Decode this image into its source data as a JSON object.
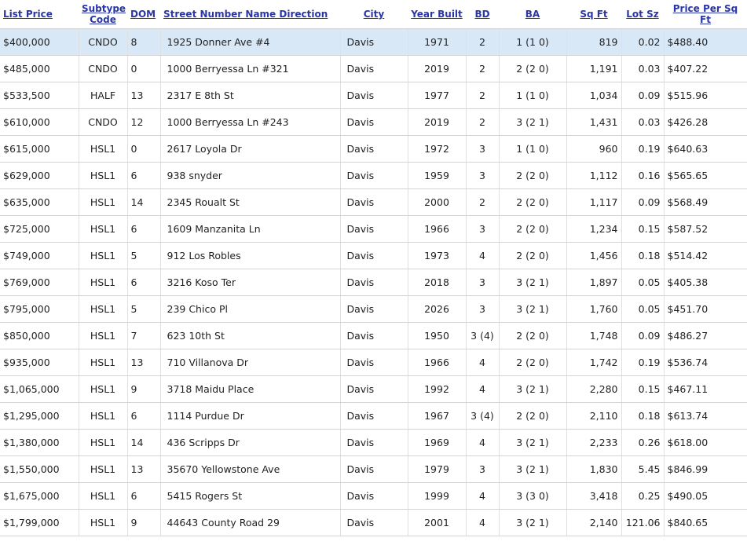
{
  "table": {
    "headers": [
      "List Price",
      "Subtype Code",
      "DOM",
      "Street Number Name Direction",
      "City",
      "Year Built",
      "BD",
      "BA",
      "Sq Ft",
      "Lot Sz",
      "Price Per Sq Ft"
    ],
    "rows": [
      [
        "$400,000",
        "CNDO",
        "8",
        "1925 Donner Ave #4",
        "Davis",
        "1971",
        "2",
        "1 (1 0)",
        "819",
        "0.02",
        "$488.40"
      ],
      [
        "$485,000",
        "CNDO",
        "0",
        "1000 Berryessa Ln #321",
        "Davis",
        "2019",
        "2",
        "2 (2 0)",
        "1,191",
        "0.03",
        "$407.22"
      ],
      [
        "$533,500",
        "HALF",
        "13",
        "2317 E 8th St",
        "Davis",
        "1977",
        "2",
        "1 (1 0)",
        "1,034",
        "0.09",
        "$515.96"
      ],
      [
        "$610,000",
        "CNDO",
        "12",
        "1000 Berryessa Ln #243",
        "Davis",
        "2019",
        "2",
        "3 (2 1)",
        "1,431",
        "0.03",
        "$426.28"
      ],
      [
        "$615,000",
        "HSL1",
        "0",
        "2617 Loyola Dr",
        "Davis",
        "1972",
        "3",
        "1 (1 0)",
        "960",
        "0.19",
        "$640.63"
      ],
      [
        "$629,000",
        "HSL1",
        "6",
        "938 snyder",
        "Davis",
        "1959",
        "3",
        "2 (2 0)",
        "1,112",
        "0.16",
        "$565.65"
      ],
      [
        "$635,000",
        "HSL1",
        "14",
        "2345 Roualt St",
        "Davis",
        "2000",
        "2",
        "2 (2 0)",
        "1,117",
        "0.09",
        "$568.49"
      ],
      [
        "$725,000",
        "HSL1",
        "6",
        "1609 Manzanita Ln",
        "Davis",
        "1966",
        "3",
        "2 (2 0)",
        "1,234",
        "0.15",
        "$587.52"
      ],
      [
        "$749,000",
        "HSL1",
        "5",
        "912 Los Robles",
        "Davis",
        "1973",
        "4",
        "2 (2 0)",
        "1,456",
        "0.18",
        "$514.42"
      ],
      [
        "$769,000",
        "HSL1",
        "6",
        "3216 Koso Ter",
        "Davis",
        "2018",
        "3",
        "3 (2 1)",
        "1,897",
        "0.05",
        "$405.38"
      ],
      [
        "$795,000",
        "HSL1",
        "5",
        "239 Chico Pl",
        "Davis",
        "2026",
        "3",
        "3 (2 1)",
        "1,760",
        "0.05",
        "$451.70"
      ],
      [
        "$850,000",
        "HSL1",
        "7",
        "623 10th St",
        "Davis",
        "1950",
        "3 (4)",
        "2 (2 0)",
        "1,748",
        "0.09",
        "$486.27"
      ],
      [
        "$935,000",
        "HSL1",
        "13",
        "710 Villanova Dr",
        "Davis",
        "1966",
        "4",
        "2 (2 0)",
        "1,742",
        "0.19",
        "$536.74"
      ],
      [
        "$1,065,000",
        "HSL1",
        "9",
        "3718 Maidu Place",
        "Davis",
        "1992",
        "4",
        "3 (2 1)",
        "2,280",
        "0.15",
        "$467.11"
      ],
      [
        "$1,295,000",
        "HSL1",
        "6",
        "1114 Purdue Dr",
        "Davis",
        "1967",
        "3 (4)",
        "2 (2 0)",
        "2,110",
        "0.18",
        "$613.74"
      ],
      [
        "$1,380,000",
        "HSL1",
        "14",
        "436 Scripps Dr",
        "Davis",
        "1969",
        "4",
        "3 (2 1)",
        "2,233",
        "0.26",
        "$618.00"
      ],
      [
        "$1,550,000",
        "HSL1",
        "13",
        "35670 Yellowstone Ave",
        "Davis",
        "1979",
        "3",
        "3 (2 1)",
        "1,830",
        "5.45",
        "$846.99"
      ],
      [
        "$1,675,000",
        "HSL1",
        "6",
        "5415 Rogers St",
        "Davis",
        "1999",
        "4",
        "3 (3 0)",
        "3,418",
        "0.25",
        "$490.05"
      ],
      [
        "$1,799,000",
        "HSL1",
        "9",
        "44643 County Road 29",
        "Davis",
        "2001",
        "4",
        "3 (2 1)",
        "2,140",
        "121.06",
        "$840.65"
      ]
    ]
  }
}
